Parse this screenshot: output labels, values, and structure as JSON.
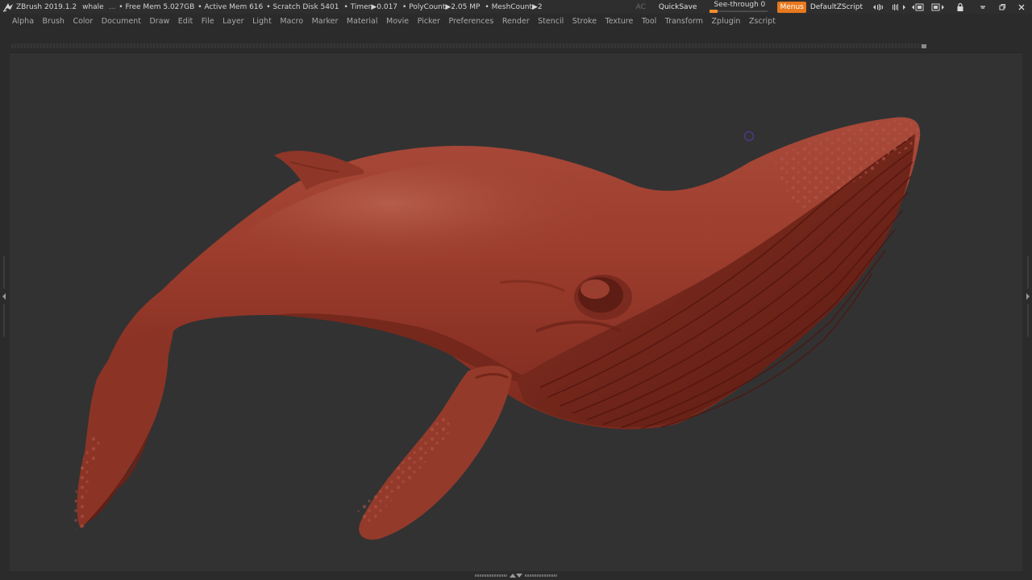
{
  "titlebar": {
    "app": "ZBrush 2019.1.2",
    "document": "whale",
    "ellipsis": "...",
    "free_mem": "• Free Mem 5.027GB",
    "active_mem": "• Active Mem 616",
    "scratch_disk": "• Scratch Disk 5401",
    "timer": "• Timer▶0.017",
    "polycount": "• PolyCount▶2.05 MP",
    "meshcount": "• MeshCount▶2",
    "ac": "AC",
    "quicksave": "QuickSave",
    "see_through_label": "See-through",
    "see_through_value": "0",
    "see_through_level": 0,
    "menus": "Menus",
    "script": "DefaultZScript"
  },
  "menubar": {
    "items": [
      "Alpha",
      "Brush",
      "Color",
      "Document",
      "Draw",
      "Edit",
      "File",
      "Layer",
      "Light",
      "Macro",
      "Marker",
      "Material",
      "Movie",
      "Picker",
      "Preferences",
      "Render",
      "Stencil",
      "Stroke",
      "Texture",
      "Tool",
      "Transform",
      "Zplugin",
      "Zscript"
    ]
  },
  "colors": {
    "accent": "#e8781d",
    "model": "#8f3325",
    "canvas": "#323232"
  },
  "icons": {
    "logo": "zbrush-logo-icon",
    "cursor": "brush-cursor-icon"
  }
}
